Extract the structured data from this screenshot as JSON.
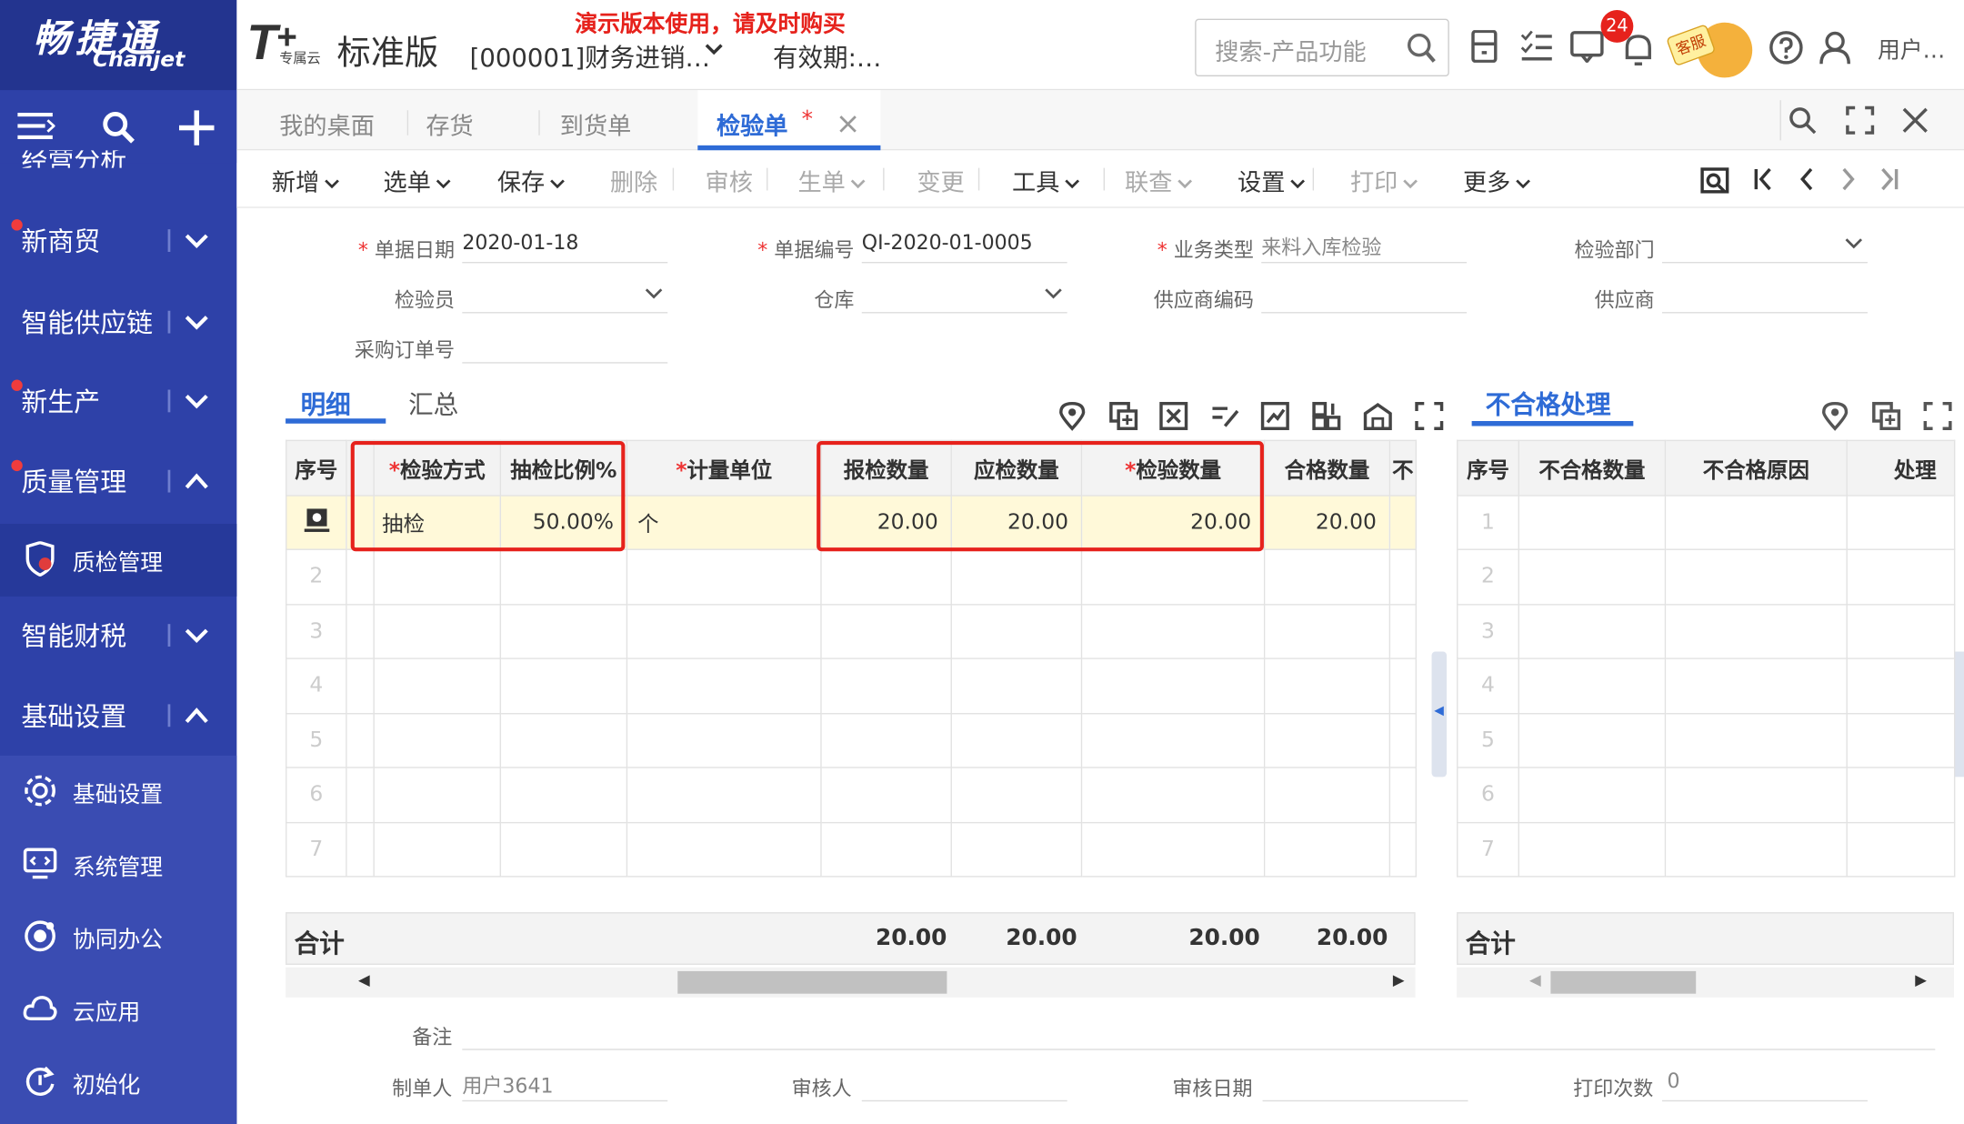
{
  "logo": {
    "cn": "畅捷通",
    "en": "Chanjet"
  },
  "topbar": {
    "brand_sub": "专属云",
    "brand_name": "标准版",
    "company": "[000001]财务进销…",
    "demo_notice": "演示版本使用，请及时购买",
    "validity": "有效期:…",
    "search_placeholder": "搜索-产品功能",
    "badge": "24",
    "service": "客服",
    "user": "用户…"
  },
  "sidebar": {
    "partial_top": "经营分析",
    "items": [
      {
        "label": "新商贸",
        "dot": true,
        "expanded": false
      },
      {
        "label": "智能供应链",
        "dot": false,
        "expanded": false
      },
      {
        "label": "新生产",
        "dot": true,
        "expanded": false
      },
      {
        "label": "质量管理",
        "dot": true,
        "expanded": true
      },
      {
        "label": "智能财税",
        "dot": false,
        "expanded": false
      },
      {
        "label": "基础设置",
        "dot": false,
        "expanded": true
      }
    ],
    "sub_quality": "质检管理",
    "sub_basic": [
      "基础设置",
      "系统管理",
      "协同办公",
      "云应用",
      "初始化"
    ]
  },
  "tabs": [
    "我的桌面",
    "存货",
    "到货单",
    "检验单"
  ],
  "active_tab_marker": "*",
  "toolbar": {
    "items": [
      "新增",
      "选单",
      "保存",
      "删除",
      "审核",
      "生单",
      "变更",
      "工具",
      "联查",
      "设置",
      "打印",
      "更多"
    ]
  },
  "form": {
    "doc_date_label": "单据日期",
    "doc_date": "2020-01-18",
    "doc_no_label": "单据编号",
    "doc_no": "QI-2020-01-0005",
    "biz_type_label": "业务类型",
    "biz_type": "来料入库检验",
    "dept_label": "检验部门",
    "dept": "",
    "inspector_label": "检验员",
    "inspector": "",
    "warehouse_label": "仓库",
    "warehouse": "",
    "supplier_code_label": "供应商编码",
    "supplier_code": "",
    "supplier_label": "供应商",
    "supplier": "",
    "po_label": "采购订单号",
    "po": ""
  },
  "detail": {
    "tabs": [
      "明细",
      "汇总"
    ],
    "headers": [
      "序号",
      "检验方式",
      "抽检比例%",
      "计量单位",
      "报检数量",
      "应检数量",
      "检验数量",
      "合格数量",
      "不"
    ],
    "rows": [
      [
        "",
        "抽检",
        "50.00%",
        "个",
        "20.00",
        "20.00",
        "20.00",
        "20.00"
      ]
    ],
    "row_indices": [
      "2",
      "3",
      "4",
      "5",
      "6",
      "7"
    ],
    "total_label": "合计",
    "totals": [
      "20.00",
      "20.00",
      "20.00",
      "20.00"
    ]
  },
  "ng": {
    "title": "不合格处理",
    "headers": [
      "序号",
      "不合格数量",
      "不合格原因",
      "处理"
    ],
    "row_indices": [
      "1",
      "2",
      "3",
      "4",
      "5",
      "6",
      "7"
    ],
    "total_label": "合计"
  },
  "footer": {
    "remark_label": "备注",
    "maker_label": "制单人",
    "maker": "用户3641",
    "auditor_label": "审核人",
    "audit_date_label": "审核日期",
    "print_count_label": "打印次数",
    "print_count": "0"
  },
  "colors": {
    "sidebar": "#2e41a8",
    "accent": "#2e6bd6",
    "highlight": "#e6221c",
    "selected_row": "#fff9d9"
  }
}
